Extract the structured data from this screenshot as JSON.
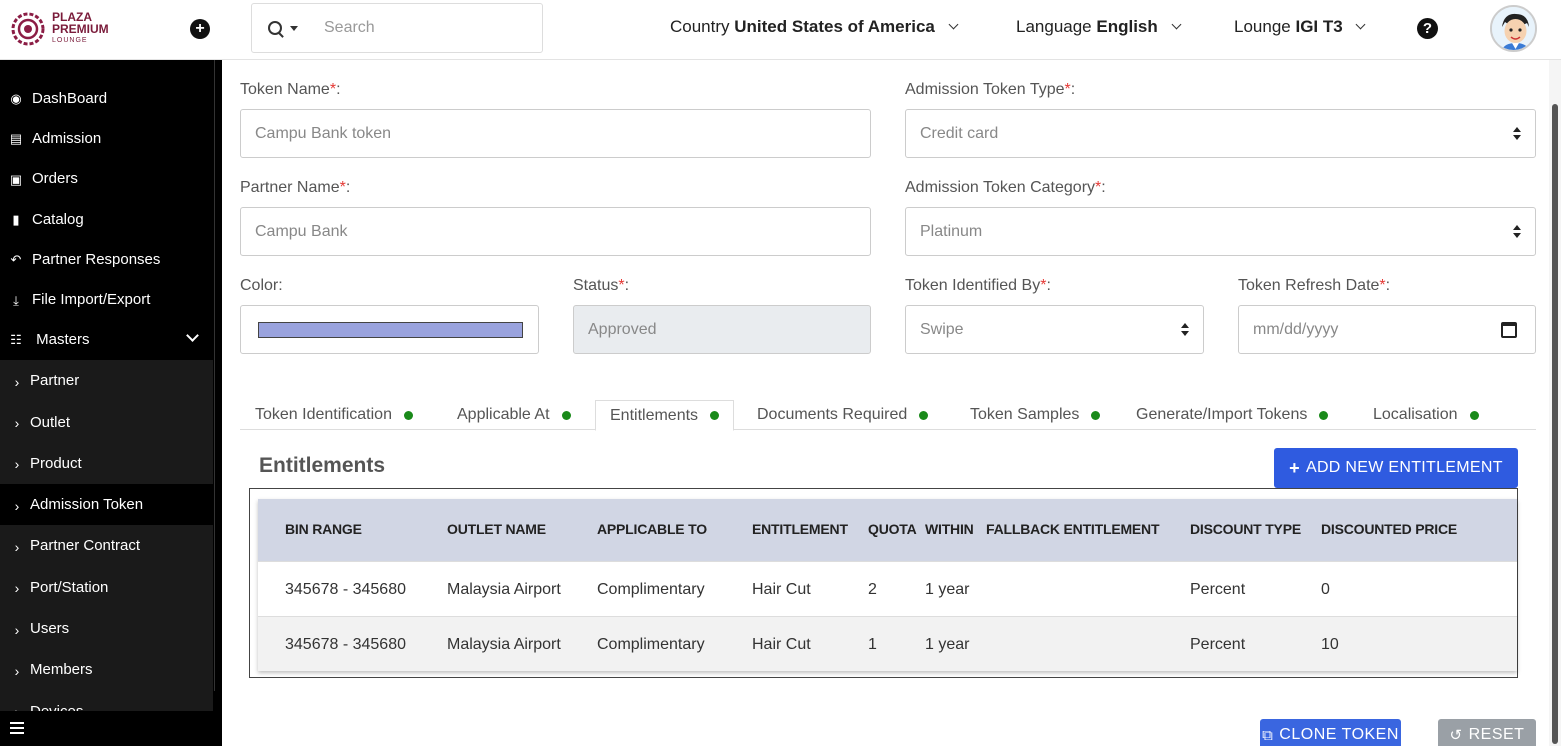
{
  "header": {
    "logo": {
      "line1": "PLAZA",
      "line2": "PREMIUM",
      "line3": "LOUNGE"
    },
    "search_placeholder": "Search",
    "country_label": "Country",
    "country_value": "United States of America",
    "language_label": "Language",
    "language_value": "English",
    "lounge_label": "Lounge",
    "lounge_value": "IGI T3",
    "help_glyph": "?"
  },
  "sidebar": {
    "items": [
      {
        "label": "DashBoard",
        "icon": "dashboard-icon"
      },
      {
        "label": "Admission",
        "icon": "id-card-icon"
      },
      {
        "label": "Orders",
        "icon": "cart-icon"
      },
      {
        "label": "Catalog",
        "icon": "file-icon"
      },
      {
        "label": "Partner Responses",
        "icon": "reply-all-icon"
      },
      {
        "label": "File Import/Export",
        "icon": "download-icon"
      },
      {
        "label": "Masters",
        "icon": "sitemap-icon"
      }
    ],
    "sub_items": [
      {
        "label": "Partner"
      },
      {
        "label": "Outlet"
      },
      {
        "label": "Product"
      },
      {
        "label": "Admission Token",
        "active": true
      },
      {
        "label": "Partner Contract"
      },
      {
        "label": "Port/Station"
      },
      {
        "label": "Users"
      },
      {
        "label": "Members"
      },
      {
        "label": "Devices"
      }
    ]
  },
  "form": {
    "token_name": {
      "label": "Token Name",
      "req": "*",
      "colon": ":",
      "value": "Campu Bank token"
    },
    "admission_token_type": {
      "label": "Admission Token Type",
      "req": "*",
      "colon": ":",
      "value": "Credit card"
    },
    "partner_name": {
      "label": "Partner Name",
      "req": "*",
      "colon": ":",
      "value": "Campu Bank"
    },
    "admission_token_category": {
      "label": "Admission Token Category",
      "req": "*",
      "colon": ":",
      "value": "Platinum"
    },
    "color": {
      "label": "Color:",
      "value": "#9aa3de"
    },
    "status": {
      "label": "Status",
      "req": "*",
      "colon": ":",
      "value": "Approved"
    },
    "token_identified_by": {
      "label": "Token Identified By",
      "req": "*",
      "colon": ":",
      "value": "Swipe"
    },
    "token_refresh_date": {
      "label": "Token Refresh Date",
      "req": "*",
      "colon": ":",
      "placeholder": "mm/dd/yyyy"
    }
  },
  "tabs": [
    {
      "label": "Token Identification"
    },
    {
      "label": "Applicable At"
    },
    {
      "label": "Entitlements",
      "active": true
    },
    {
      "label": "Documents Required"
    },
    {
      "label": "Token Samples"
    },
    {
      "label": "Generate/Import Tokens"
    },
    {
      "label": "Localisation"
    }
  ],
  "entitlements": {
    "title": "Entitlements",
    "add_button": "ADD NEW ENTITLEMENT",
    "columns": [
      "BIN RANGE",
      "OUTLET NAME",
      "APPLICABLE TO",
      "ENTITLEMENT",
      "QUOTA",
      "WITHIN",
      "FALLBACK ENTITLEMENT",
      "DISCOUNT TYPE",
      "DISCOUNTED PRICE"
    ],
    "rows": [
      [
        "345678 - 345680",
        "Malaysia Airport",
        "Complimentary",
        "Hair Cut",
        "2",
        "1 year",
        "",
        "Percent",
        "0"
      ],
      [
        "345678 - 345680",
        "Malaysia Airport",
        "Complimentary",
        "Hair Cut",
        "1",
        "1 year",
        "",
        "Percent",
        "10"
      ]
    ]
  },
  "actions": {
    "clone": "CLONE TOKEN",
    "reset": "RESET"
  },
  "colors": {
    "primary": "#2f5be0",
    "status_dot": "#1a8a1a",
    "required": "#e53935",
    "table_header": "#d1d6e4"
  }
}
